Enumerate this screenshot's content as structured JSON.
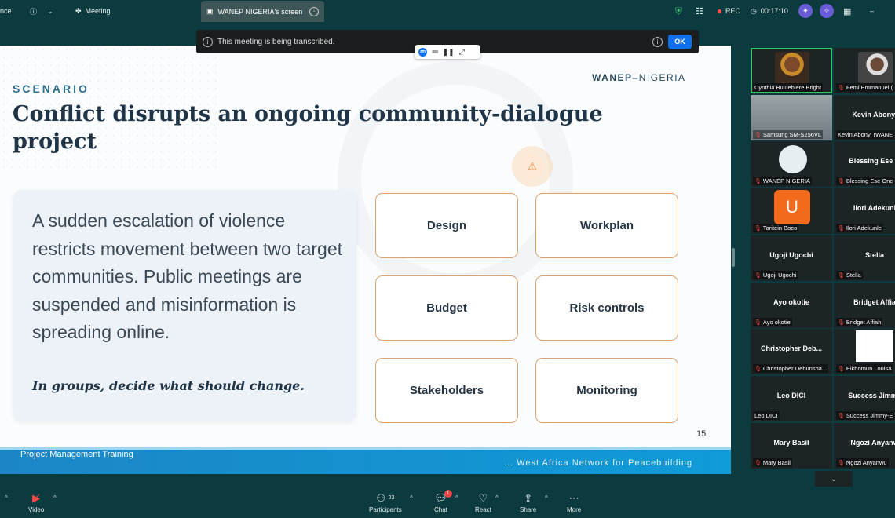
{
  "top_bar": {
    "left_fragment": "nce",
    "meeting_label": "Meeting",
    "screen_tab_label": "WANEP NIGERIA's screen",
    "rec_label": "REC",
    "timer": "00:17:10"
  },
  "banner": {
    "message": "This meeting is being transcribed.",
    "ok_label": "OK",
    "zm_label": "zm"
  },
  "slide": {
    "kicker": "SCENARIO",
    "logo_left": "WANEP",
    "logo_right": "–NIGERIA",
    "title": "Conflict disrupts an ongoing community-dialogue project",
    "scenario_text": "A sudden escalation of violence restricts movement between two target communities. Public meetings are suspended and misinformation is spreading online.",
    "prompt": "In groups, decide what should change.",
    "options": [
      "Design",
      "Workplan",
      "Budget",
      "Risk controls",
      "Stakeholders",
      "Monitoring"
    ],
    "page_number": "15",
    "footer_left": "Project Management Training",
    "footer_right": "... West Africa Network for Peacebuilding"
  },
  "participants": [
    {
      "name": "",
      "label": "Cynthia Buluebiere Bright",
      "muted": false,
      "photo": "person"
    },
    {
      "name": "",
      "label": "Femi Emmanuel (",
      "muted": true,
      "photo": "person2"
    },
    {
      "name": "",
      "label": "Samsung SM-S256VL",
      "muted": true,
      "photo": "blur"
    },
    {
      "name": "Kevin Abonyi",
      "label": "Kevin Abonyi (WANE",
      "muted": false,
      "photo": ""
    },
    {
      "name": "",
      "label": "WANEP NIGERIA",
      "muted": true,
      "photo": "logo"
    },
    {
      "name": "Blessing Ese O",
      "label": "Blessing Ese Onc",
      "muted": true,
      "photo": ""
    },
    {
      "name": "",
      "label": "Taritein Boco",
      "muted": true,
      "photo": "U"
    },
    {
      "name": "Ilori Adekunl",
      "label": "Ilori Adekunle",
      "muted": true,
      "photo": ""
    },
    {
      "name": "Ugoji Ugochi",
      "label": "Ugoji Ugochi",
      "muted": true,
      "photo": ""
    },
    {
      "name": "Stella",
      "label": "Stella",
      "muted": true,
      "photo": ""
    },
    {
      "name": "Ayo okotie",
      "label": "Ayo okotie",
      "muted": true,
      "photo": ""
    },
    {
      "name": "Bridget Affia",
      "label": "Bridget Affiah",
      "muted": true,
      "photo": ""
    },
    {
      "name": "Christopher Deb...",
      "label": "Christopher Debunsha...",
      "muted": true,
      "photo": ""
    },
    {
      "name": "",
      "label": "Eikhomun Louisa",
      "muted": true,
      "photo": "africa"
    },
    {
      "name": "Leo DICI",
      "label": "Leo DICI",
      "muted": false,
      "photo": ""
    },
    {
      "name": "Success Jimmy",
      "label": "Success Jimmy-E",
      "muted": true,
      "photo": ""
    },
    {
      "name": "Mary Basil",
      "label": "Mary Basil",
      "muted": true,
      "photo": ""
    },
    {
      "name": "Ngozi Anyanw",
      "label": "Ngozi Anyanwu",
      "muted": true,
      "photo": ""
    }
  ],
  "toolbar": {
    "video": "Video",
    "participants": "Participants",
    "participants_count": "23",
    "chat": "Chat",
    "chat_badge": "1",
    "react": "React",
    "share": "Share",
    "more": "More"
  },
  "colors": {
    "app_bg": "#0b3b3f",
    "accent_blue": "#0e71eb",
    "option_border": "#d9a26c",
    "title": "#1f3446"
  }
}
